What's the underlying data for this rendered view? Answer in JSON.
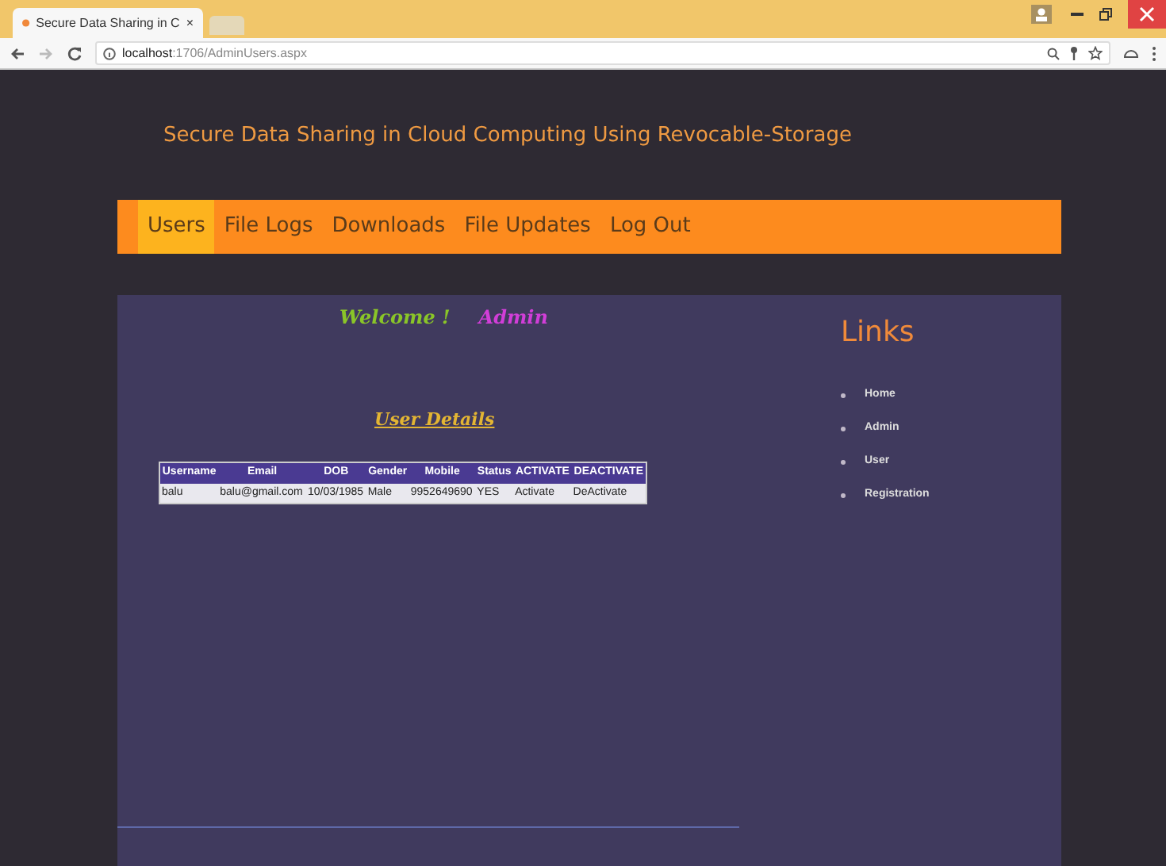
{
  "browser": {
    "tab_title": "Secure Data Sharing in C",
    "tab_close": "×",
    "url_host": "localhost",
    "url_path": ":1706/AdminUsers.aspx"
  },
  "site_title": "Secure Data Sharing in Cloud Computing Using Revocable-Storage",
  "nav": [
    {
      "label": "Users",
      "selected": true
    },
    {
      "label": "File Logs",
      "selected": false
    },
    {
      "label": "Downloads",
      "selected": false
    },
    {
      "label": "File Updates",
      "selected": false
    },
    {
      "label": "Log Out",
      "selected": false
    }
  ],
  "welcome": {
    "greeting": "Welcome !",
    "user": "Admin"
  },
  "section_title": "User Details",
  "table": {
    "columns": [
      "Username",
      "Email",
      "DOB",
      "Gender",
      "Mobile",
      "Status",
      "ACTIVATE",
      "DEACTIVATE"
    ],
    "rows": [
      [
        "balu",
        "balu@gmail.com",
        "10/03/1985",
        "Male",
        "9952649690",
        "YES",
        "Activate",
        "DeActivate"
      ]
    ]
  },
  "links": {
    "title": "Links",
    "items": [
      "Home",
      "Admin",
      "User",
      "Registration"
    ]
  }
}
